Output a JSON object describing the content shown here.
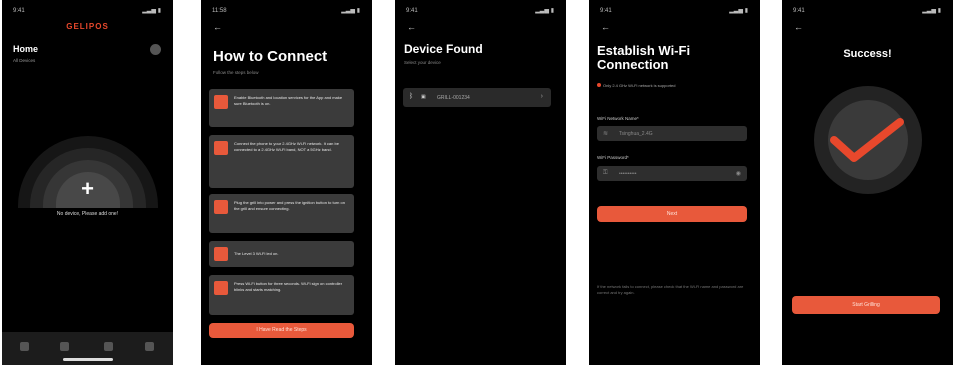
{
  "screen1": {
    "time": "9:41",
    "logo": "GELIPOS",
    "title": "Home",
    "subtitle": "All Devices",
    "empty_text": "No device, Please add one!",
    "tabs": [
      "home-icon",
      "device-icon",
      "help-icon",
      "profile-icon"
    ]
  },
  "screen2": {
    "time": "11:58",
    "title": "How to Connect",
    "subtitle": "Follow the steps below",
    "steps": [
      "Enable Bluetooth and location services for the App and make sure Bluetooth is on.",
      "Connect the phone to your 2.4GHz Wi-Fi network. It can be connected to a 2.4GHz Wi-Fi band, NOT a 5GHz band.",
      "Plug the grill into power and press the ignition button to turn on the grill and ensure connecting.",
      "The Level 3 Wi-Fi led on.",
      "Press Wi-Fi button for three seconds. Wi-Fi sign on controller blinks and starts matching."
    ],
    "button": "I Have Read the Steps"
  },
  "screen3": {
    "time": "9:41",
    "title": "Device Found",
    "subtitle": "Select your device",
    "device_name": "GRILL-001234"
  },
  "screen4": {
    "time": "9:41",
    "title_line1": "Establish Wi-Fi",
    "title_line2": "Connection",
    "hint": "Only 2.4 GHz Wi-Fi network is supported",
    "network_label": "WiFi Network Name*",
    "network_value": "Tsinghua_2.4G",
    "password_label": "WiFi Password*",
    "password_value": "••••••••••",
    "button": "Next",
    "note": "If the network fails to connect, please check that the Wi-Fi name and password are correct and try again."
  },
  "screen5": {
    "time": "9:41",
    "title": "Success!",
    "button": "Start Grilling"
  },
  "colors": {
    "accent": "#e8593b",
    "background": "#000000"
  }
}
